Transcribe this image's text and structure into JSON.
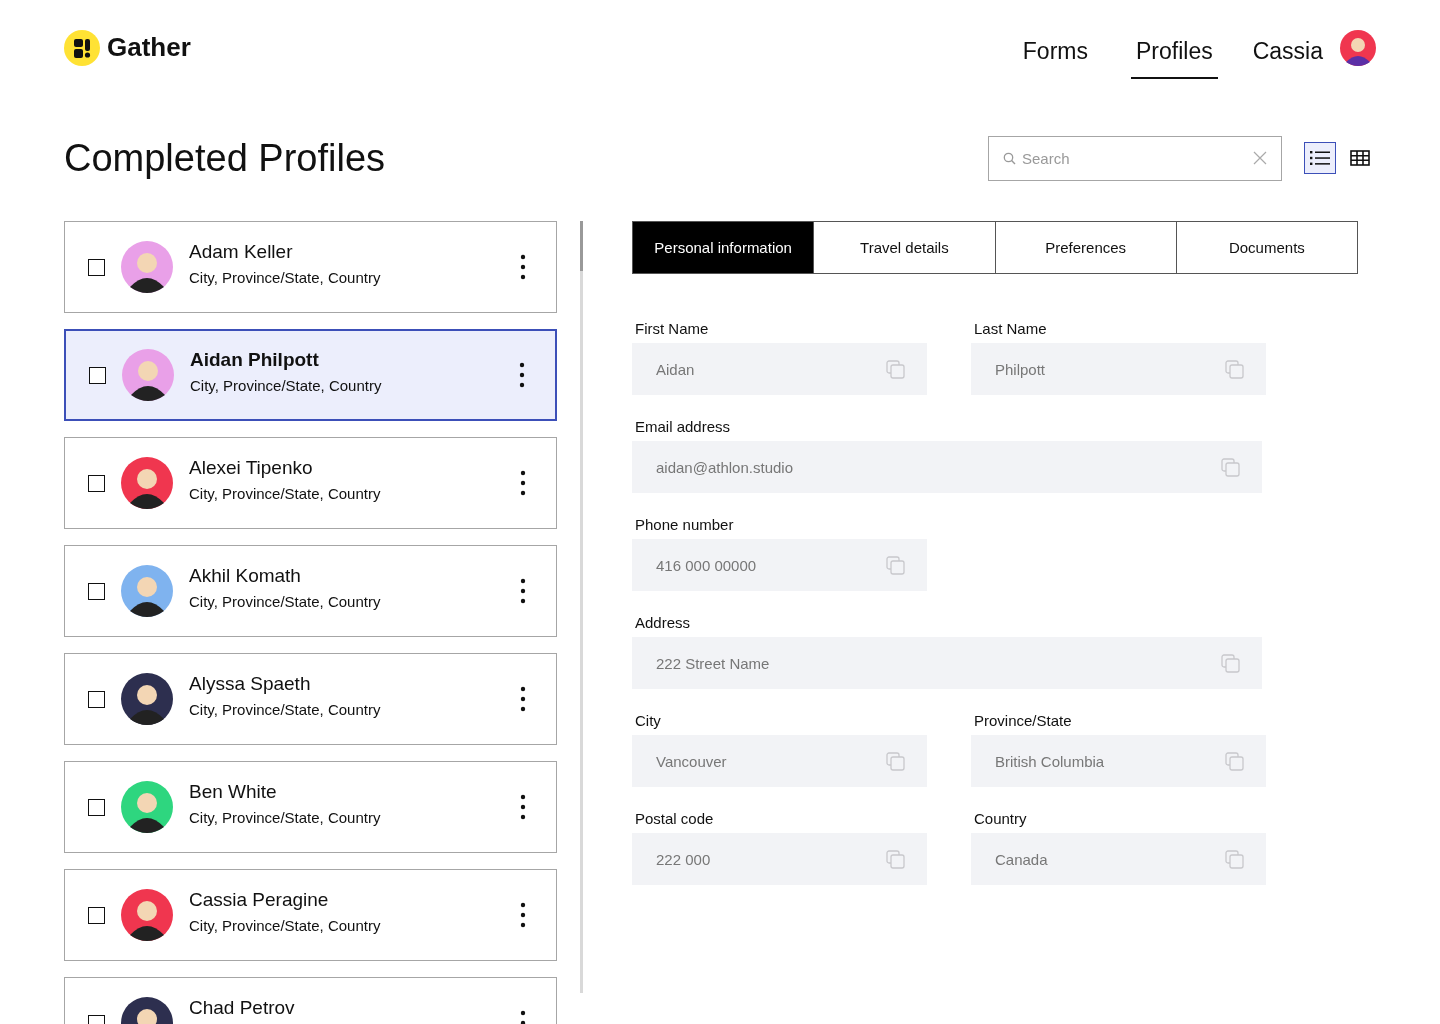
{
  "brand": {
    "name": "Gather"
  },
  "nav": [
    {
      "label": "Forms",
      "selected": false
    },
    {
      "label": "Profiles",
      "selected": true
    }
  ],
  "user": {
    "name": "Cassia",
    "color": "#f0364f"
  },
  "page_title": "Completed Profiles",
  "search": {
    "placeholder": "Search"
  },
  "view_toggle": [
    {
      "kind": "list",
      "selected": true
    },
    {
      "kind": "grid",
      "selected": false
    }
  ],
  "profiles": [
    {
      "name": "Adam Keller",
      "location": "City, Province/State, Country",
      "checked": false,
      "selected": false,
      "color": "#e9a0e8"
    },
    {
      "name": "Aidan Philpott",
      "location": "City, Province/State, Country",
      "checked": false,
      "selected": true,
      "color": "#e9a0e8"
    },
    {
      "name": "Alexei Tipenko",
      "location": "City, Province/State, Country",
      "checked": false,
      "selected": false,
      "color": "#f0364f"
    },
    {
      "name": "Akhil Komath",
      "location": "City, Province/State, Country",
      "checked": false,
      "selected": false,
      "color": "#7fb3ef"
    },
    {
      "name": "Alyssa Spaeth",
      "location": "City, Province/State, Country",
      "checked": false,
      "selected": false,
      "color": "#2d2f4f"
    },
    {
      "name": "Ben White",
      "location": "City, Province/State, Country",
      "checked": false,
      "selected": false,
      "color": "#2ed67f"
    },
    {
      "name": "Cassia Peragine",
      "location": "City, Province/State, Country",
      "checked": false,
      "selected": false,
      "color": "#f0364f"
    },
    {
      "name": "Chad Petrov",
      "checked": false,
      "selected": false,
      "color": "#2d2f4f"
    }
  ],
  "tabs": [
    {
      "label": "Personal information",
      "selected": true
    },
    {
      "label": "Travel details",
      "selected": false
    },
    {
      "label": "Preferences",
      "selected": false
    },
    {
      "label": "Documents",
      "selected": false
    }
  ],
  "fields": [
    {
      "label": "First Name",
      "value": "Aidan",
      "kind": "half"
    },
    {
      "label": "Last Name",
      "value": "Philpott",
      "kind": "half"
    },
    {
      "label": "Email address",
      "value": "aidan@athlon.studio",
      "kind": "full"
    },
    {
      "label": "Phone number",
      "value": "416 000 00000",
      "kind": "half"
    },
    {
      "label": "Address",
      "value": "222 Street Name",
      "kind": "full"
    },
    {
      "label": "City",
      "value": "Vancouver",
      "kind": "half"
    },
    {
      "label": "Province/State",
      "value": "British Columbia",
      "kind": "half"
    },
    {
      "label": "Postal code",
      "value": "222 000",
      "kind": "half"
    },
    {
      "label": "Country",
      "value": "Canada",
      "kind": "half"
    }
  ]
}
